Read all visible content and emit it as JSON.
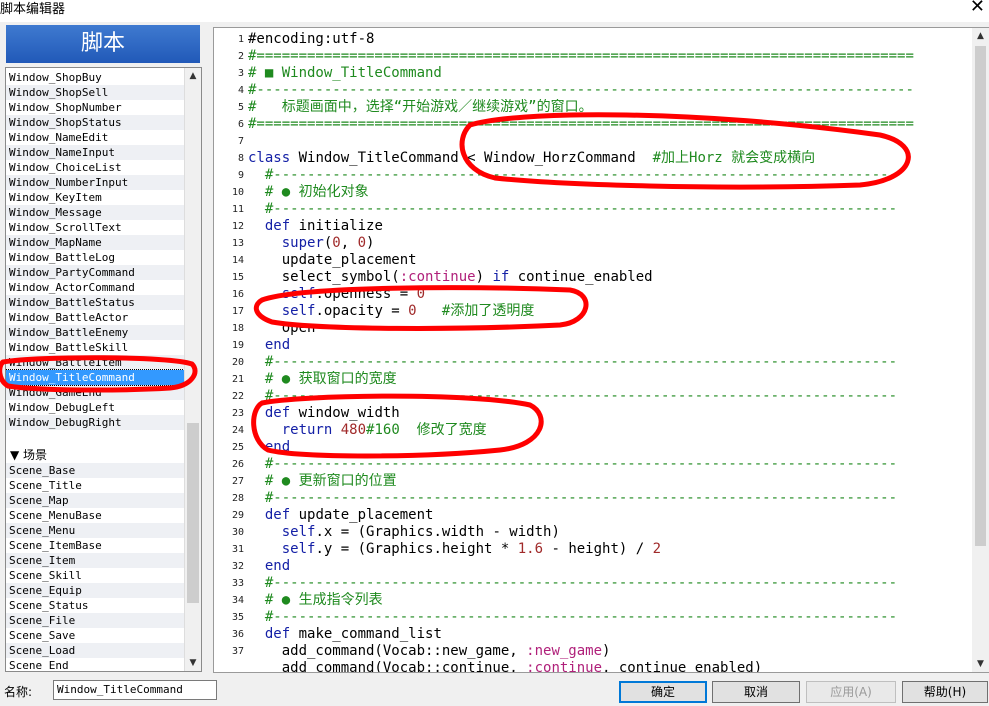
{
  "window": {
    "title": "脚本编辑器",
    "close_glyph": "✕"
  },
  "sidebar": {
    "header": "脚本",
    "items": [
      "Window_ShopBuy",
      "Window_ShopSell",
      "Window_ShopNumber",
      "Window_ShopStatus",
      "Window_NameEdit",
      "Window_NameInput",
      "Window_ChoiceList",
      "Window_NumberInput",
      "Window_KeyItem",
      "Window_Message",
      "Window_ScrollText",
      "Window_MapName",
      "Window_BattleLog",
      "Window_PartyCommand",
      "Window_ActorCommand",
      "Window_BattleStatus",
      "Window_BattleActor",
      "Window_BattleEnemy",
      "Window_BattleSkill",
      "Window_BattleItem",
      "Window_TitleCommand",
      "Window_GameEnd",
      "Window_DebugLeft",
      "Window_DebugRight"
    ],
    "selected_index": 20,
    "group_label": "▼ 场景",
    "scene_items": [
      "Scene_Base",
      "Scene_Title",
      "Scene_Map",
      "Scene_MenuBase",
      "Scene_Menu",
      "Scene_ItemBase",
      "Scene_Item",
      "Scene_Skill",
      "Scene_Equip",
      "Scene_Status",
      "Scene_File",
      "Scene_Save",
      "Scene_Load",
      "Scene_End"
    ],
    "scroll_up": "▲",
    "scroll_down": "▼"
  },
  "editor": {
    "line_numbers": [
      "1",
      "2",
      "3",
      "4",
      "5",
      "6",
      "7",
      "8",
      "9",
      "10",
      "11",
      "12",
      "13",
      "14",
      "15",
      "16",
      "17",
      "18",
      "19",
      "20",
      "21",
      "22",
      "23",
      "24",
      "25",
      "26",
      "27",
      "28",
      "29",
      "30",
      "31",
      "32",
      "33",
      "34",
      "35",
      "36",
      "37"
    ],
    "lines": [
      [
        [
          "c",
          "#encoding:utf-8"
        ]
      ],
      [
        [
          "cm",
          "#=============================================================================="
        ]
      ],
      [
        [
          "cm",
          "# ■ Window_TitleCommand"
        ]
      ],
      [
        [
          "cm",
          "#------------------------------------------------------------------------------"
        ]
      ],
      [
        [
          "cm",
          "#   标题画面中，选择“开始游戏／继续游戏”的窗口。"
        ]
      ],
      [
        [
          "cm",
          "#=============================================================================="
        ]
      ],
      [
        [
          "c",
          ""
        ]
      ],
      [
        [
          "kw",
          "class"
        ],
        [
          "c",
          " Window_TitleCommand < Window_HorzCommand  "
        ],
        [
          "cm",
          "#加上Horz 就会变成横向"
        ]
      ],
      [
        [
          "cm",
          "  #--------------------------------------------------------------------------"
        ]
      ],
      [
        [
          "cm",
          "  # ● 初始化对象"
        ]
      ],
      [
        [
          "cm",
          "  #--------------------------------------------------------------------------"
        ]
      ],
      [
        [
          "kw",
          "  def"
        ],
        [
          "c",
          " initialize"
        ]
      ],
      [
        [
          "kw",
          "    super"
        ],
        [
          "c",
          "("
        ],
        [
          "num",
          "0"
        ],
        [
          "c",
          ", "
        ],
        [
          "num",
          "0"
        ],
        [
          "c",
          ")"
        ]
      ],
      [
        [
          "c",
          "    update_placement"
        ]
      ],
      [
        [
          "c",
          "    select_symbol("
        ],
        [
          "sym",
          ":continue"
        ],
        [
          "c",
          ") "
        ],
        [
          "kw",
          "if"
        ],
        [
          "c",
          " continue_enabled"
        ]
      ],
      [
        [
          "kw",
          "    self"
        ],
        [
          "c",
          ".openness = "
        ],
        [
          "num",
          "0"
        ]
      ],
      [
        [
          "kw",
          "    self"
        ],
        [
          "c",
          ".opacity = "
        ],
        [
          "num",
          "0"
        ],
        [
          "c",
          "   "
        ],
        [
          "cm",
          "#添加了透明度"
        ]
      ],
      [
        [
          "c",
          "    open"
        ]
      ],
      [
        [
          "kw",
          "  end"
        ]
      ],
      [
        [
          "cm",
          "  #--------------------------------------------------------------------------"
        ]
      ],
      [
        [
          "cm",
          "  # ● 获取窗口的宽度"
        ]
      ],
      [
        [
          "cm",
          "  #--------------------------------------------------------------------------"
        ]
      ],
      [
        [
          "kw",
          "  def"
        ],
        [
          "c",
          " window_width"
        ]
      ],
      [
        [
          "kw",
          "    return"
        ],
        [
          "c",
          " "
        ],
        [
          "num",
          "480"
        ],
        [
          "cm",
          "#160  修改了宽度"
        ]
      ],
      [
        [
          "kw",
          "  end"
        ]
      ],
      [
        [
          "cm",
          "  #--------------------------------------------------------------------------"
        ]
      ],
      [
        [
          "cm",
          "  # ● 更新窗口的位置"
        ]
      ],
      [
        [
          "cm",
          "  #--------------------------------------------------------------------------"
        ]
      ],
      [
        [
          "kw",
          "  def"
        ],
        [
          "c",
          " update_placement"
        ]
      ],
      [
        [
          "kw",
          "    self"
        ],
        [
          "c",
          ".x = (Graphics.width - width)"
        ]
      ],
      [
        [
          "kw",
          "    self"
        ],
        [
          "c",
          ".y = (Graphics.height * "
        ],
        [
          "num",
          "1.6"
        ],
        [
          "c",
          " - height) / "
        ],
        [
          "num",
          "2"
        ]
      ],
      [
        [
          "kw",
          "  end"
        ]
      ],
      [
        [
          "cm",
          "  #--------------------------------------------------------------------------"
        ]
      ],
      [
        [
          "cm",
          "  # ● 生成指令列表"
        ]
      ],
      [
        [
          "cm",
          "  #--------------------------------------------------------------------------"
        ]
      ],
      [
        [
          "kw",
          "  def"
        ],
        [
          "c",
          " make_command_list"
        ]
      ],
      [
        [
          "c",
          "    add_command(Vocab::new_game, "
        ],
        [
          "sym",
          ":new_game"
        ],
        [
          "c",
          ")"
        ]
      ],
      [
        [
          "c",
          "    add_command(Vocab::continue, "
        ],
        [
          "sym",
          ":continue"
        ],
        [
          "c",
          ", continue_enabled)"
        ]
      ]
    ]
  },
  "footer": {
    "name_label": "名称:",
    "name_value": "Window_TitleCommand",
    "ok": "确定",
    "cancel": "取消",
    "apply": "应用(A)",
    "help": "帮助(H)"
  },
  "colors": {
    "annotation": "#ff0000",
    "comment": "#1f8a1f",
    "keyword": "#1420a6",
    "selection": "#3399ff"
  }
}
